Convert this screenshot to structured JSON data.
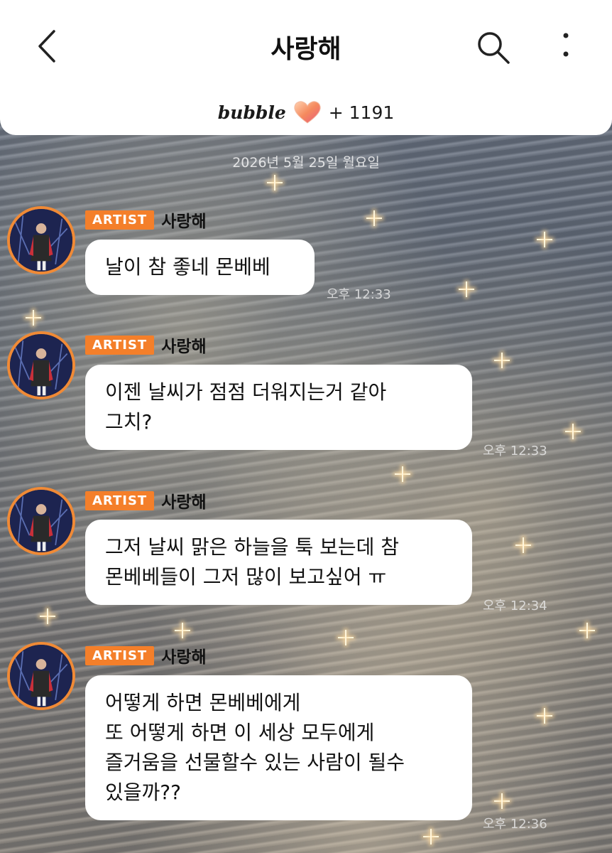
{
  "header": {
    "title": "사랑해",
    "brand": "bubble",
    "count": "+ 1191"
  },
  "date_separator": "2026년 5월 25일 월요일",
  "messages": [
    {
      "badge": "ARTIST",
      "sender": "사랑해",
      "text": "날이 참 좋네 몬베베",
      "time": "오후 12:33"
    },
    {
      "badge": "ARTIST",
      "sender": "사랑해",
      "text": "이젠 날씨가 점점 더워지는거 같아\n그치?",
      "time": "오후 12:33"
    },
    {
      "badge": "ARTIST",
      "sender": "사랑해",
      "text": "그저 날씨 맑은 하늘을 툭 보는데 참\n몬베베들이 그저 많이 보고싶어 ㅠ",
      "time": "오후 12:34"
    },
    {
      "badge": "ARTIST",
      "sender": "사랑해",
      "text": "어떻게 하면 몬베베에게\n또 어떻게 하면 이 세상 모두에게\n즐거움을 선물할수 있는 사람이 될수\n있을까??",
      "time": "오후 12:36"
    }
  ],
  "colors": {
    "badge": "#f47f2a",
    "avatar_ring": "#f08a36",
    "header_bg": "#ffffff"
  }
}
